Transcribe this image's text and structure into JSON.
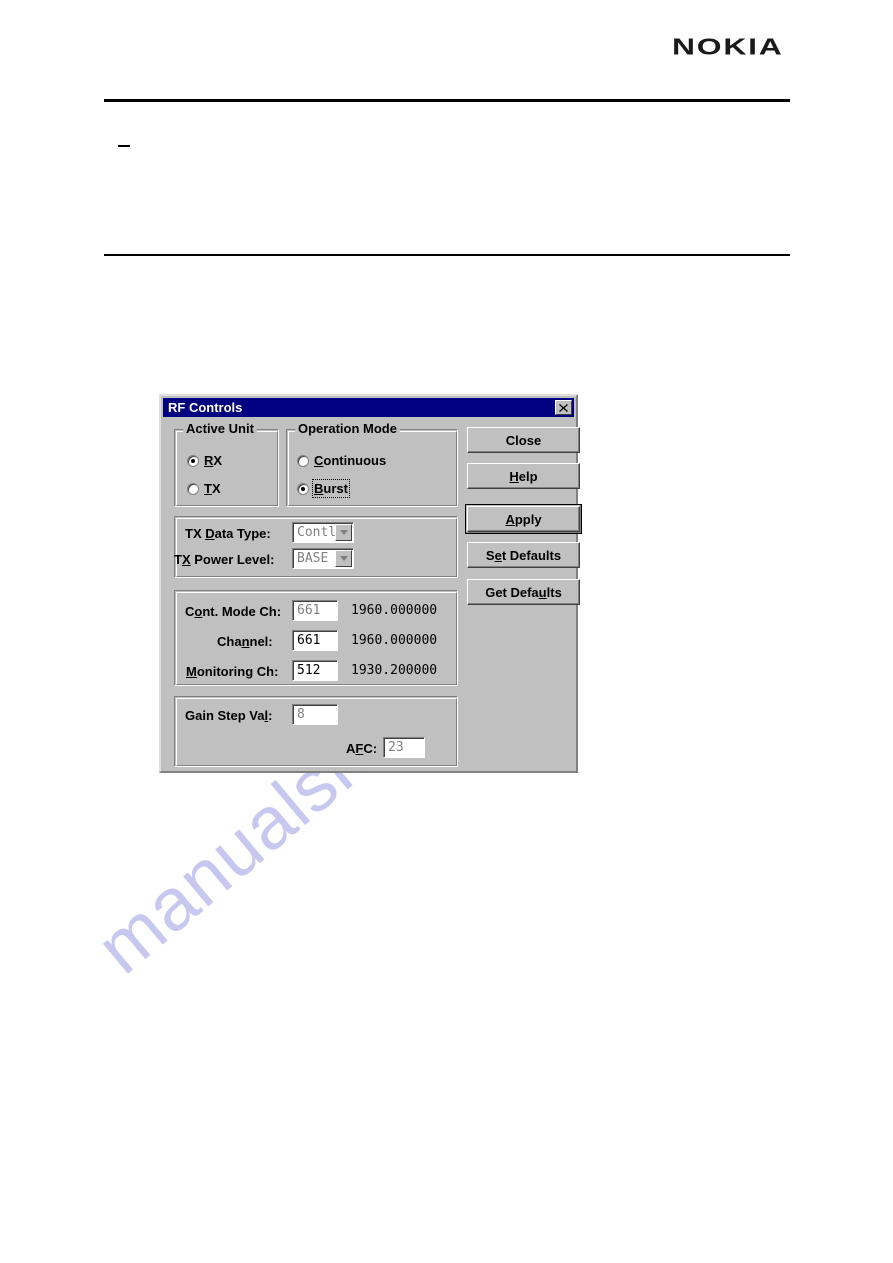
{
  "page": {
    "brand": "NOKIA"
  },
  "dialog": {
    "title": "RF Controls",
    "close_icon": "close-x-icon",
    "active_unit": {
      "title": "Active Unit",
      "options": [
        {
          "label_pre": "",
          "label_accel": "R",
          "label_post": "X",
          "full": "RX",
          "selected": true
        },
        {
          "label_pre": "",
          "label_accel": "T",
          "label_post": "X",
          "full": "TX",
          "selected": false
        }
      ]
    },
    "operation_mode": {
      "title": "Operation Mode",
      "options": [
        {
          "label_pre": "",
          "label_accel": "C",
          "label_post": "ontinuous",
          "full": "Continuous",
          "selected": false,
          "focused": false
        },
        {
          "label_pre": "",
          "label_accel": "B",
          "label_post": "urst",
          "full": "Burst",
          "selected": true,
          "focused": true
        }
      ]
    },
    "tx_panel": {
      "rows": [
        {
          "label_pre": "TX ",
          "label_accel": "D",
          "label_post": "ata Type:",
          "full_label": "TX Data Type:",
          "value": "Contl",
          "disabled": true,
          "control": "combobox"
        },
        {
          "label_pre": "T",
          "label_accel": "X",
          "label_post": " Power Level:",
          "full_label": "TX Power Level:",
          "value": "BASE",
          "disabled": true,
          "control": "combobox"
        }
      ]
    },
    "channel_panel": {
      "rows": [
        {
          "label_pre": "C",
          "label_accel": "o",
          "label_post": "nt. Mode Ch:",
          "full_label": "Cont. Mode Ch:",
          "value": "661",
          "frequency": "1960.000000",
          "disabled": true
        },
        {
          "label_pre": "Cha",
          "label_accel": "n",
          "label_post": "nel:",
          "full_label": "Channel:",
          "value": "661",
          "frequency": "1960.000000",
          "disabled": false
        },
        {
          "label_pre": "",
          "label_accel": "M",
          "label_post": "onitoring Ch:",
          "full_label": "Monitoring Ch:",
          "value": "512",
          "frequency": "1930.200000",
          "disabled": false
        }
      ]
    },
    "gain_panel": {
      "rows": [
        {
          "label_pre": "Gain Step Va",
          "label_accel": "l",
          "label_post": ":",
          "full_label": "Gain Step Val:",
          "value": "8",
          "disabled": true
        },
        {
          "label_pre": "A",
          "label_accel": "F",
          "label_post": "C:",
          "full_label": "AFC:",
          "value": "23",
          "disabled": true
        }
      ]
    },
    "buttons": [
      {
        "label_pre": "",
        "label_accel": "",
        "label_post": "Close",
        "full": "Close",
        "default": false
      },
      {
        "label_pre": "",
        "label_accel": "H",
        "label_post": "elp",
        "full": "Help",
        "default": false
      },
      {
        "label_pre": "",
        "label_accel": "A",
        "label_post": "pply",
        "full": "Apply",
        "default": true
      },
      {
        "label_pre": "S",
        "label_accel": "e",
        "label_post": "t Defaults",
        "full": "Set Defaults",
        "default": false
      },
      {
        "label_pre": "Get Defa",
        "label_accel": "u",
        "label_post": "lts",
        "full": "Get Defaults",
        "default": false
      }
    ]
  },
  "watermark": {
    "text": "manualshive.com",
    "color": "#c7c8ef"
  },
  "colors": {
    "titlebar": "#000080",
    "dialog_face": "#c0c0c0",
    "field_bg": "#ffffff",
    "disabled_text": "#808080"
  }
}
